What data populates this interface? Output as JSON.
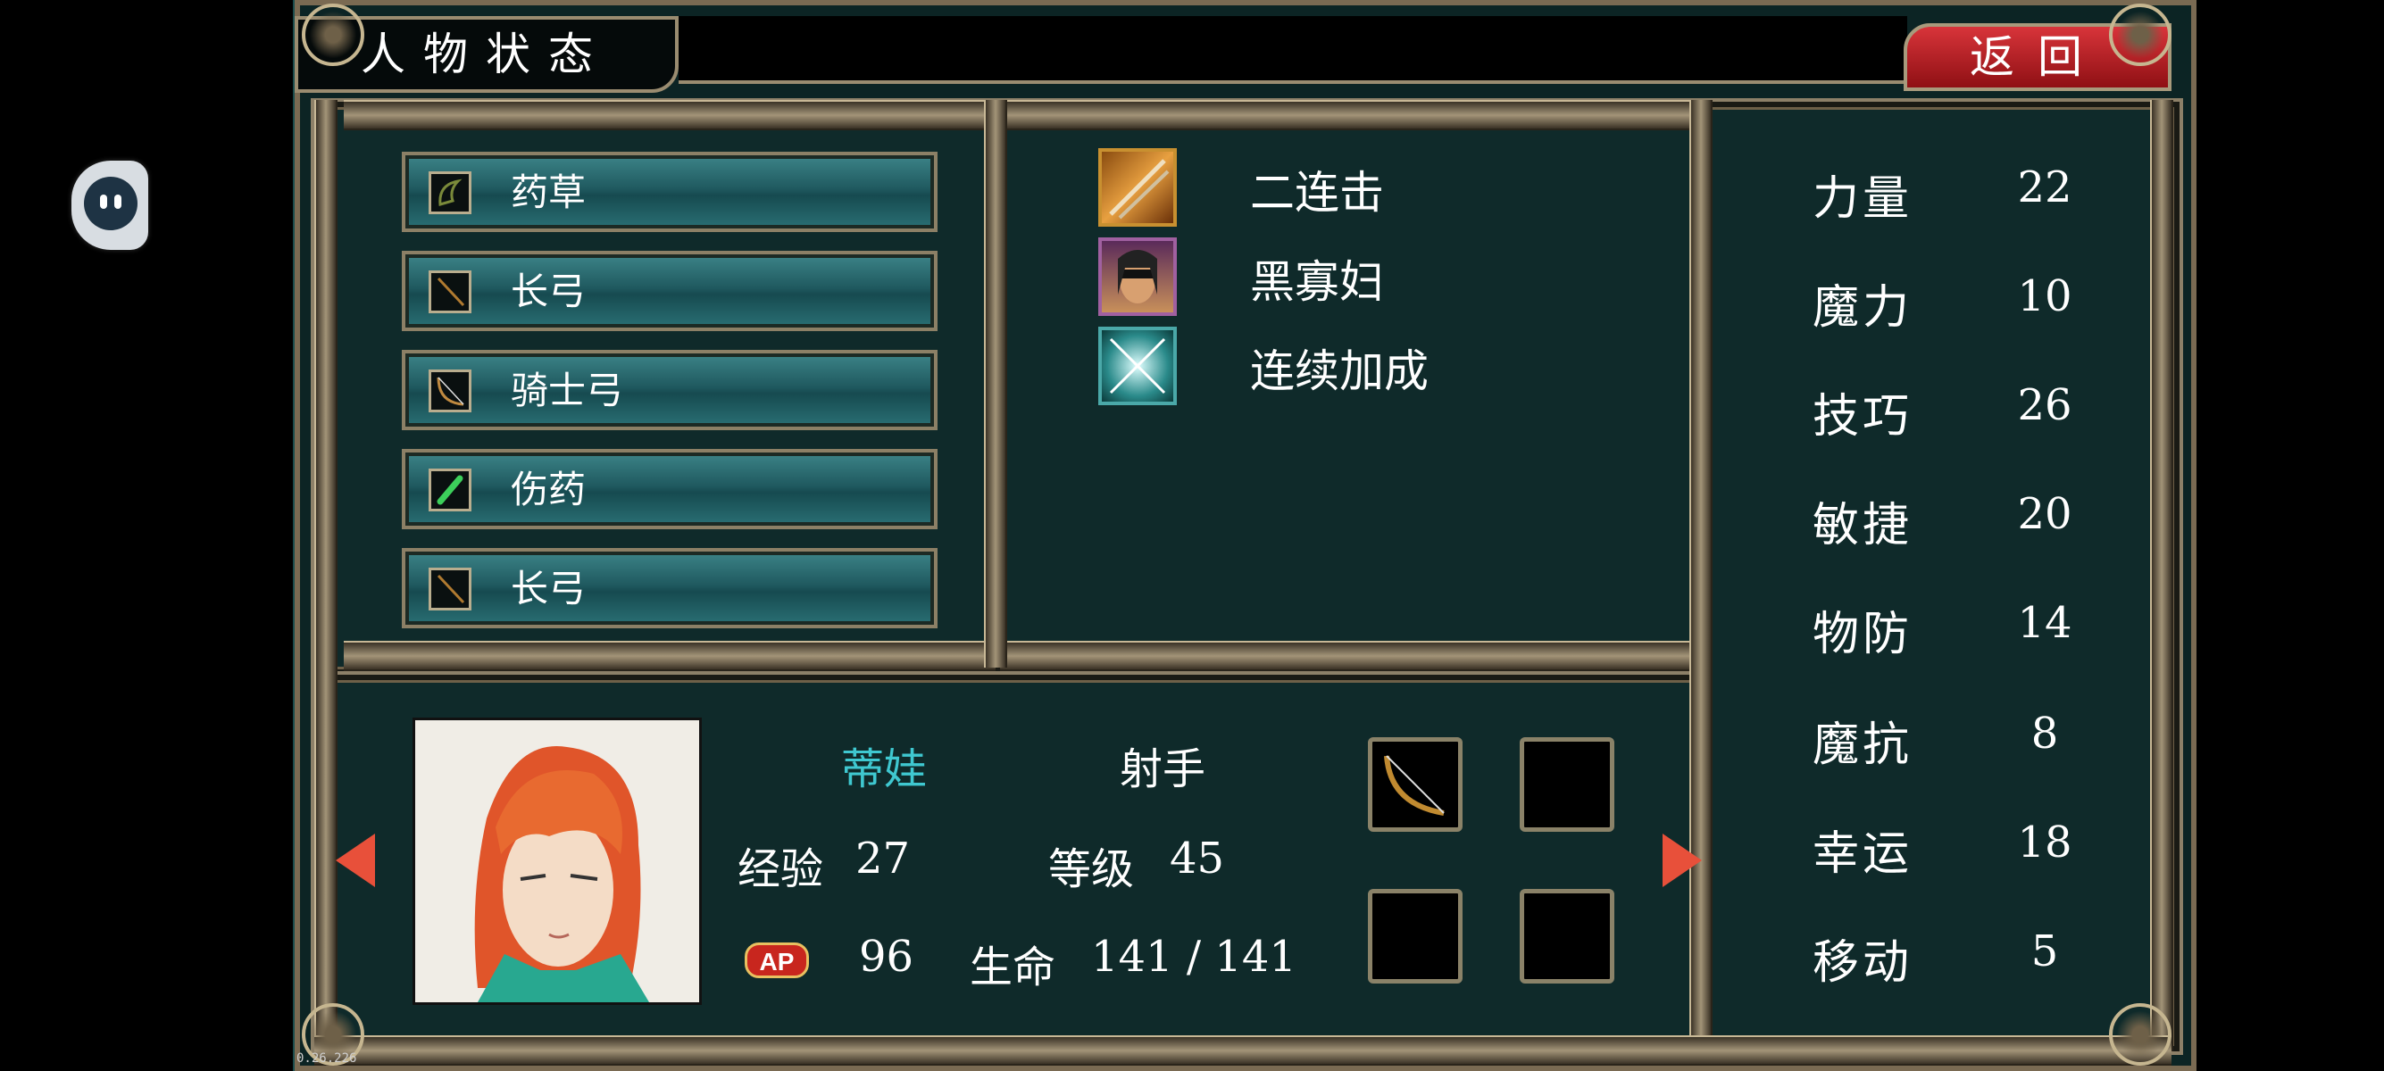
{
  "title": "人物状态",
  "back_label": "返回",
  "items": [
    {
      "label": "药草",
      "icon": "herb-icon"
    },
    {
      "label": "长弓",
      "icon": "longbow-icon"
    },
    {
      "label": "骑士弓",
      "icon": "knight-bow-icon"
    },
    {
      "label": "伤药",
      "icon": "potion-icon"
    },
    {
      "label": "长弓",
      "icon": "longbow-icon"
    }
  ],
  "skills": [
    {
      "label": "二连击",
      "icon": "double-strike-icon"
    },
    {
      "label": "黑寡妇",
      "icon": "black-widow-icon"
    },
    {
      "label": "连续加成",
      "icon": "combo-bonus-icon"
    }
  ],
  "stats": [
    {
      "name": "力量",
      "value": "22"
    },
    {
      "name": "魔力",
      "value": "10"
    },
    {
      "name": "技巧",
      "value": "26"
    },
    {
      "name": "敏捷",
      "value": "20"
    },
    {
      "name": "物防",
      "value": "14"
    },
    {
      "name": "魔抗",
      "value": "8"
    },
    {
      "name": "幸运",
      "value": "18"
    },
    {
      "name": "移动",
      "value": "5"
    }
  ],
  "character": {
    "name": "蒂娃",
    "class": "射手",
    "exp_label": "经验",
    "exp": "27",
    "level_label": "等级",
    "level": "45",
    "ap_badge": "AP",
    "ap": "96",
    "hp_label": "生命",
    "hp": "141 / 141"
  },
  "version": "0.26.226",
  "colors": {
    "name_color": "#3fc8d0",
    "back_button": "#c8242a",
    "item_bar": "#26686c",
    "panel_bg": "#0f2a2a"
  }
}
